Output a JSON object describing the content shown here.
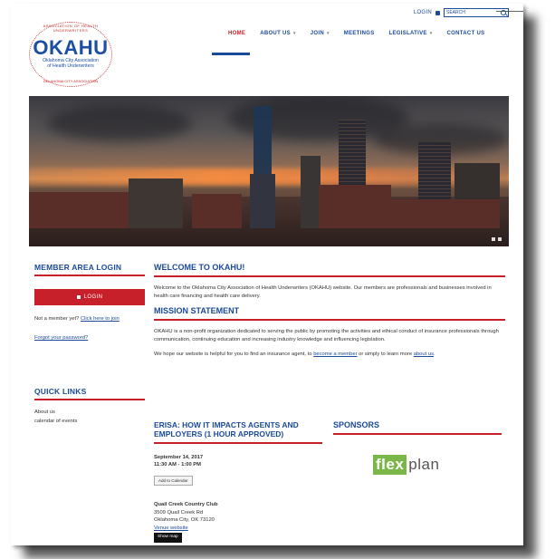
{
  "header": {
    "login_label": "LOGIN",
    "search_placeholder": "SEARCH",
    "logo": {
      "word": "OKAHU",
      "subtitle": "Oklahoma City Association of Health Underwriters",
      "ring_top": "ASSOCIATION OF HEALTH UNDERWRITERS",
      "ring_bottom": "OKLAHOMA CITY ASSOCIATION"
    },
    "nav": [
      {
        "label": "HOME",
        "active": true
      },
      {
        "label": "ABOUT US",
        "caret": "▾"
      },
      {
        "label": "JOIN",
        "caret": "▾"
      },
      {
        "label": "MEETINGS"
      },
      {
        "label": "LEGISLATIVE",
        "caret": "▾"
      },
      {
        "label": "CONTACT US"
      }
    ]
  },
  "member": {
    "title": "MEMBER AREA LOGIN",
    "login_button": "LOGIN",
    "not_member": "Not a member yet?",
    "click_here": "Click here to join",
    "forgot": "Forgot your password?"
  },
  "quick_links": {
    "title": "QUICK LINKS",
    "items": [
      "About us",
      "calendar of events"
    ]
  },
  "welcome": {
    "title": "WELCOME TO OKAHU!",
    "text": "Welcome to the Oklahoma City Association of Health Underwriters (OKAHU) website. Our members are professionals and businesses involved in health care financing and health care delivery."
  },
  "mission": {
    "title": "MISSION STATEMENT",
    "text": "OKAHU is a non-profit organization dedicated to serving the public by promoting the activities and ethical conduct of insurance professionals through communication, continuing education and increasing industry knowledge and influencing legislation.",
    "cta_prefix": "We hope our website is helpful for you to find an insurance agent, to",
    "cta_link1": "become a member",
    "cta_mid": "or simply to learn more",
    "cta_link2": "about us",
    "cta_end": "."
  },
  "event": {
    "title": "ERISA: HOW IT IMPACTS AGENTS AND EMPLOYERS (1 HOUR APPROVED)",
    "date": "September 14, 2017",
    "time": "11:30 AM - 1:00 PM",
    "tag": "Add to Calendar",
    "venue": "Quail Creek Country Club",
    "street": "3509 Quail Creek Rd",
    "city": "Oklahoma City, OK 73120",
    "venue_link": "Venue website",
    "map_button": "Show map"
  },
  "sponsors": {
    "title": "SPONSORS",
    "logo_left": "flex",
    "logo_right": "plan"
  },
  "colors": {
    "brand_blue": "#1b4a9a",
    "brand_red": "#c8202a",
    "sponsor_green": "#7ab648"
  }
}
